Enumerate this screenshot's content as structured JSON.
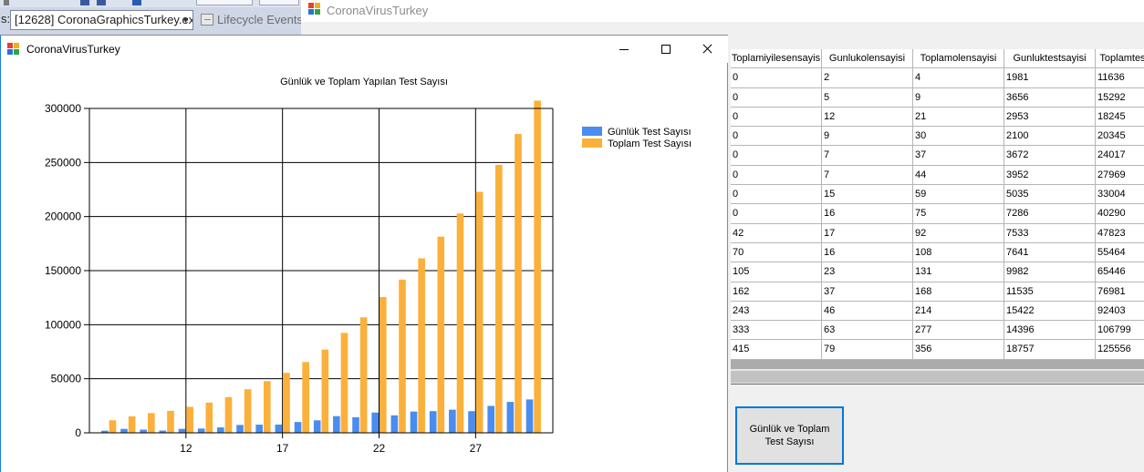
{
  "ide": {
    "process_combo": "[12628] CoronaGraphicsTurkey.exe",
    "lifecycle_label": "Lifecycle Events"
  },
  "back_window": {
    "title": "CoronaVirusTurkey",
    "grid": {
      "columns": [
        "Toplamiyilesensayis",
        "Gunlukolensayisi",
        "Toplamolensayisi",
        "Gunluktestsayisi",
        "Toplamtes"
      ],
      "rows": [
        [
          "0",
          "2",
          "4",
          "1981",
          "11636"
        ],
        [
          "0",
          "5",
          "9",
          "3656",
          "15292"
        ],
        [
          "0",
          "12",
          "21",
          "2953",
          "18245"
        ],
        [
          "0",
          "9",
          "30",
          "2100",
          "20345"
        ],
        [
          "0",
          "7",
          "37",
          "3672",
          "24017"
        ],
        [
          "0",
          "7",
          "44",
          "3952",
          "27969"
        ],
        [
          "0",
          "15",
          "59",
          "5035",
          "33004"
        ],
        [
          "0",
          "16",
          "75",
          "7286",
          "40290"
        ],
        [
          "42",
          "17",
          "92",
          "7533",
          "47823"
        ],
        [
          "70",
          "16",
          "108",
          "7641",
          "55464"
        ],
        [
          "105",
          "23",
          "131",
          "9982",
          "65446"
        ],
        [
          "162",
          "37",
          "168",
          "11535",
          "76981"
        ],
        [
          "243",
          "46",
          "214",
          "15422",
          "92403"
        ],
        [
          "333",
          "63",
          "277",
          "14396",
          "106799"
        ],
        [
          "415",
          "79",
          "356",
          "18757",
          "125556"
        ]
      ]
    },
    "chart_button_label": "Günlük ve Toplam Test Sayısı"
  },
  "front_window": {
    "title": "CoronaVirusTurkey"
  },
  "colors": {
    "daily": "#4a8cf0",
    "total": "#fbb03b",
    "focus_border": "#0078d7"
  },
  "chart_data": {
    "type": "bar",
    "title": "Günlük ve Toplam Yapılan Test Sayısı",
    "x": [
      8,
      9,
      10,
      11,
      12,
      13,
      14,
      15,
      16,
      17,
      18,
      19,
      20,
      21,
      22,
      23,
      24,
      25,
      26,
      27,
      28,
      29,
      30
    ],
    "xticks": [
      12,
      17,
      22,
      27
    ],
    "yticks": [
      0,
      50000,
      100000,
      150000,
      200000,
      250000,
      300000
    ],
    "ylim": [
      0,
      300000
    ],
    "grid": true,
    "legend_position": "top-right",
    "series": [
      {
        "name": "Günlük Test Sayısı",
        "values": [
          1981,
          3656,
          2953,
          2100,
          3672,
          3952,
          5035,
          7286,
          7533,
          7641,
          9982,
          11535,
          15422,
          14396,
          18757,
          16160,
          19664,
          20065,
          21400,
          20023,
          24900,
          28578,
          30864
        ]
      },
      {
        "name": "Toplam Test Sayısı",
        "values": [
          11636,
          15292,
          18245,
          20345,
          24017,
          27969,
          33004,
          40290,
          47823,
          55464,
          65446,
          76981,
          92403,
          106799,
          125556,
          141716,
          161380,
          181445,
          202845,
          222868,
          247768,
          276346,
          307210
        ]
      }
    ]
  }
}
